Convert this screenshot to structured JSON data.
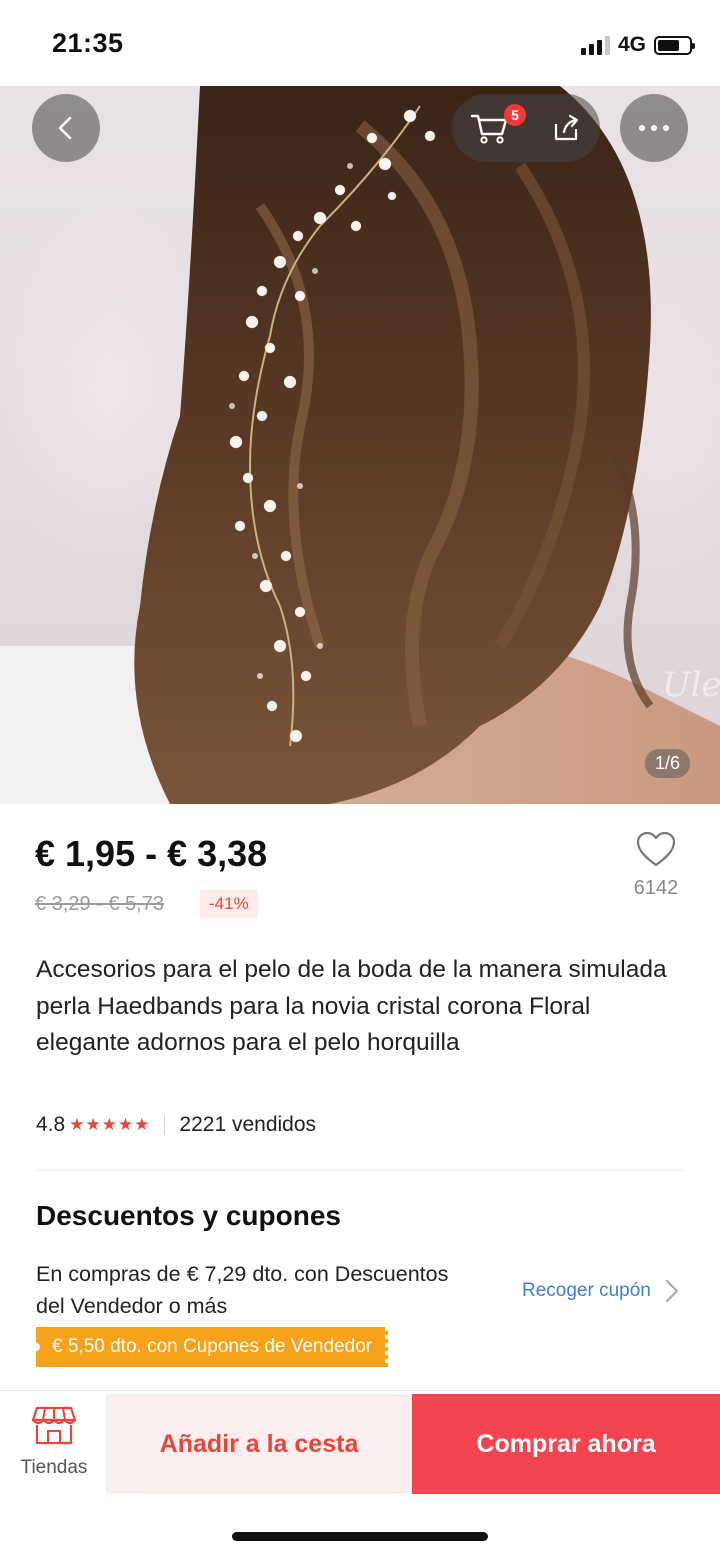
{
  "status_bar": {
    "time": "21:35",
    "network": "4G"
  },
  "hero": {
    "image_counter": "1/6",
    "cart_count": "5",
    "icons": {
      "back": "back-chevron-icon",
      "cart": "cart-icon",
      "share": "share-icon",
      "more": "more-dots-icon"
    }
  },
  "product": {
    "price_range": "€ 1,95 - € 3,38",
    "original_price": "€ 3,29 - € 5,73",
    "discount": "-41%",
    "wishlist_count": "6142",
    "title": "Accesorios para el pelo de la boda de la manera simulada perla Haedbands para la novia cristal corona Floral elegante adornos para el pelo horquilla",
    "rating": "4.8",
    "stars": "★★★★★",
    "sold": "2221 vendidos"
  },
  "coupons": {
    "section_title": "Descuentos y cupones",
    "description": "En compras de € 7,29 dto. con Descuentos del Vendedor o más",
    "collect_label": "Recoger cupón",
    "tag": "€ 5,50 dto. con Cupones de Vendedor"
  },
  "bottom_bar": {
    "stores_label": "Tiendas",
    "add_to_cart": "Añadir a la cesta",
    "buy_now": "Comprar ahora"
  },
  "colors": {
    "accent": "#e8453c",
    "buy_button": "#f2454f",
    "coupon": "#f7a21b",
    "link": "#3d7fd8"
  }
}
